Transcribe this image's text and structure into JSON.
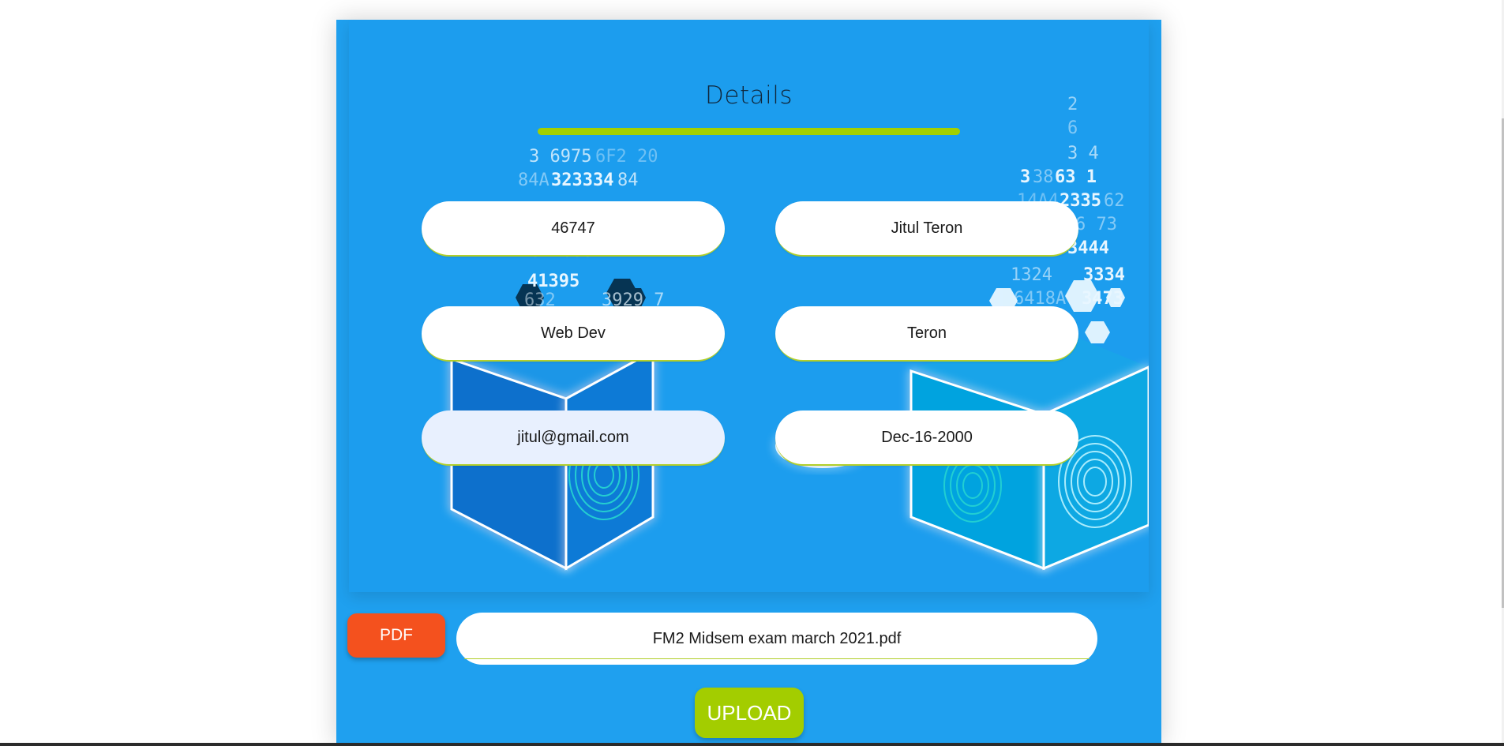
{
  "form": {
    "title": "Details",
    "fields": [
      {
        "value": "46747"
      },
      {
        "value": "Jitul Teron"
      },
      {
        "value": "Web Dev"
      },
      {
        "value": "Teron"
      },
      {
        "value": "jitul@gmail.com"
      },
      {
        "value": "Dec-16-2000"
      }
    ]
  },
  "upload": {
    "pdf_label": "PDF",
    "file_name": "FM2 Midsem exam march 2021.pdf",
    "upload_label": "UPLOAD"
  },
  "colors": {
    "card_bg": "#1fa0ef",
    "accent_green": "#a3cd00",
    "pdf_orange": "#f4511e",
    "autofill_bg": "#e8f0fe"
  }
}
